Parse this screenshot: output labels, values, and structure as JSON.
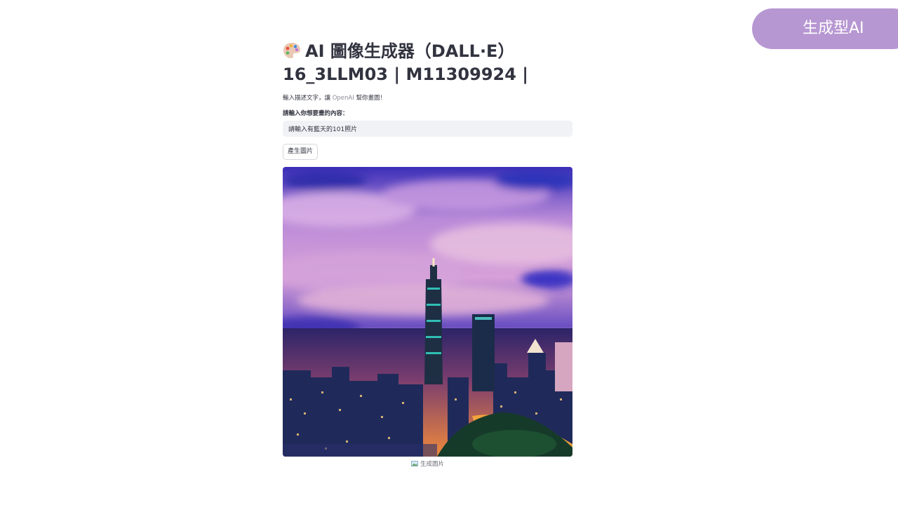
{
  "tag": {
    "label": "生成型AI",
    "color": "#b797d2"
  },
  "app": {
    "title_line1": "AI 圖像生成器（DALL·E）",
    "title_line2": "16_3LLM03 | M11309924 |",
    "title_icon": "palette-icon",
    "subtitle_before": "輸入描述文字，讓",
    "subtitle_brand": "OpenAI",
    "subtitle_after": "幫你畫圖！",
    "prompt_label": "請輸入你想要畫的內容：",
    "prompt_value": "請輸入有藍天的101照片",
    "generate_button": "產生圖片",
    "image_caption": "生成圖片",
    "caption_icon": "picture-icon"
  },
  "image": {
    "subject": "Taipei 101 skyline at dusk",
    "colors": {
      "sky_purple": "#b98ad8",
      "sky_blue": "#2a2ac8",
      "city_glow": "#f08a3c"
    }
  }
}
